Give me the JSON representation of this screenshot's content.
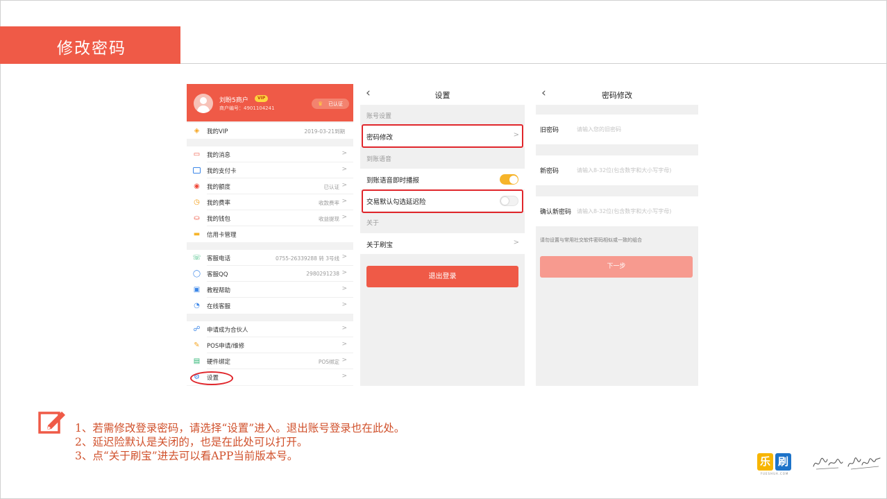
{
  "slide": {
    "title": "修改密码",
    "notes": [
      "1、若需修改登录密码，请选择“设置”进入。退出账号登录也在此处。",
      "2、延迟险默认是关闭的，也是在此处可以打开。",
      "3、点“关于刷宝”进去可以看APP当前版本号。"
    ]
  },
  "profile_screen": {
    "user_name": "刘盼5商户",
    "vip_badge": "VIP",
    "merchant_no": "商户编号：4901104241",
    "verified": "已认证",
    "vip_row": {
      "icon": "diamond-icon",
      "label": "我的VIP",
      "value": "2019-03-21到期"
    },
    "group1": [
      {
        "icon": "message-icon",
        "label": "我的消息",
        "value": ""
      },
      {
        "icon": "card-icon",
        "label": "我的支付卡",
        "value": ""
      },
      {
        "icon": "quota-icon",
        "label": "我的额度",
        "value": "已认证"
      },
      {
        "icon": "rate-icon",
        "label": "我的费率",
        "value": "收款费率"
      },
      {
        "icon": "wallet-icon",
        "label": "我的钱包",
        "value": "收益提现"
      },
      {
        "icon": "credit-card-icon",
        "label": "信用卡管理",
        "value": ""
      }
    ],
    "group2": [
      {
        "icon": "phone-icon",
        "label": "客服电话",
        "value": "0755-26339288 转 3号线"
      },
      {
        "icon": "qq-icon",
        "label": "客服QQ",
        "value": "2980291238"
      },
      {
        "icon": "tutorial-icon",
        "label": "教程帮助",
        "value": ""
      },
      {
        "icon": "headset-icon",
        "label": "在线客服",
        "value": ""
      }
    ],
    "group3": [
      {
        "icon": "partner-icon",
        "label": "申请成为合伙人",
        "value": ""
      },
      {
        "icon": "pos-icon",
        "label": "POS申请/维修",
        "value": ""
      },
      {
        "icon": "hardware-icon",
        "label": "硬件绑定",
        "value": "POS绑定"
      },
      {
        "icon": "settings-icon",
        "label": "设置",
        "value": ""
      }
    ],
    "colors": {
      "brand": "#ef5a47",
      "highlight": "#e0262b"
    }
  },
  "settings_screen": {
    "title": "设置",
    "section_account": "账号设置",
    "password_change": "密码修改",
    "section_voice": "到账语音",
    "voice_broadcast": {
      "label": "到账语音即时播报",
      "on": true
    },
    "delay_insurance": {
      "label": "交易默认勾选延迟险",
      "on": false
    },
    "section_about": "关于",
    "about": "关于刷宝",
    "logout": "退出登录",
    "toggle_on_color": "#f6b42a"
  },
  "password_screen": {
    "title": "密码修改",
    "old_password": {
      "label": "旧密码",
      "placeholder": "请输入您的旧密码"
    },
    "new_password": {
      "label": "新密码",
      "placeholder": "请输入8-32位(包含数字和大小写字母)"
    },
    "confirm_password": {
      "label": "确认新密码",
      "placeholder": "请输入8-32位(包含数字和大小写字母)"
    },
    "hint": "请勿设置与常用社交软件密码相似或一致的组合",
    "next": "下一步"
  },
  "brand": {
    "logo_chars": [
      "乐",
      "刷"
    ],
    "logo_site": "YUESHUA.COM"
  }
}
